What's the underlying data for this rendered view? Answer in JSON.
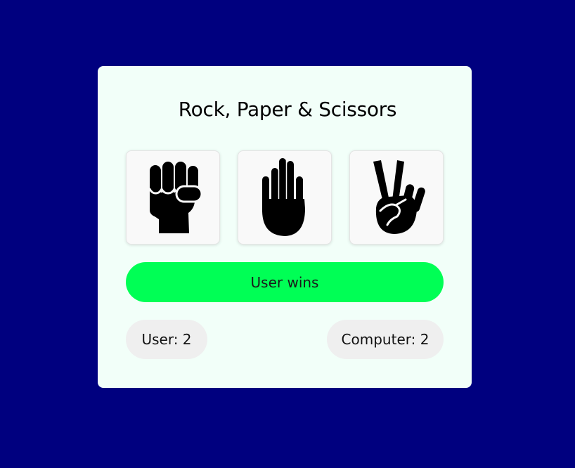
{
  "game": {
    "title": "Rock, Paper & Scissors",
    "choices": [
      {
        "name": "rock",
        "icon": "fist-icon"
      },
      {
        "name": "paper",
        "icon": "open-hand-icon"
      },
      {
        "name": "scissors",
        "icon": "victory-hand-icon"
      }
    ],
    "result_text": "User wins",
    "score": {
      "user_text": "User: 2",
      "user": 2,
      "computer_text": "Computer: 2",
      "computer": 2
    }
  },
  "colors": {
    "background": "#00007f",
    "card": "#f2fff9",
    "result_win": "#00ff55",
    "score_pill": "#efefef"
  }
}
